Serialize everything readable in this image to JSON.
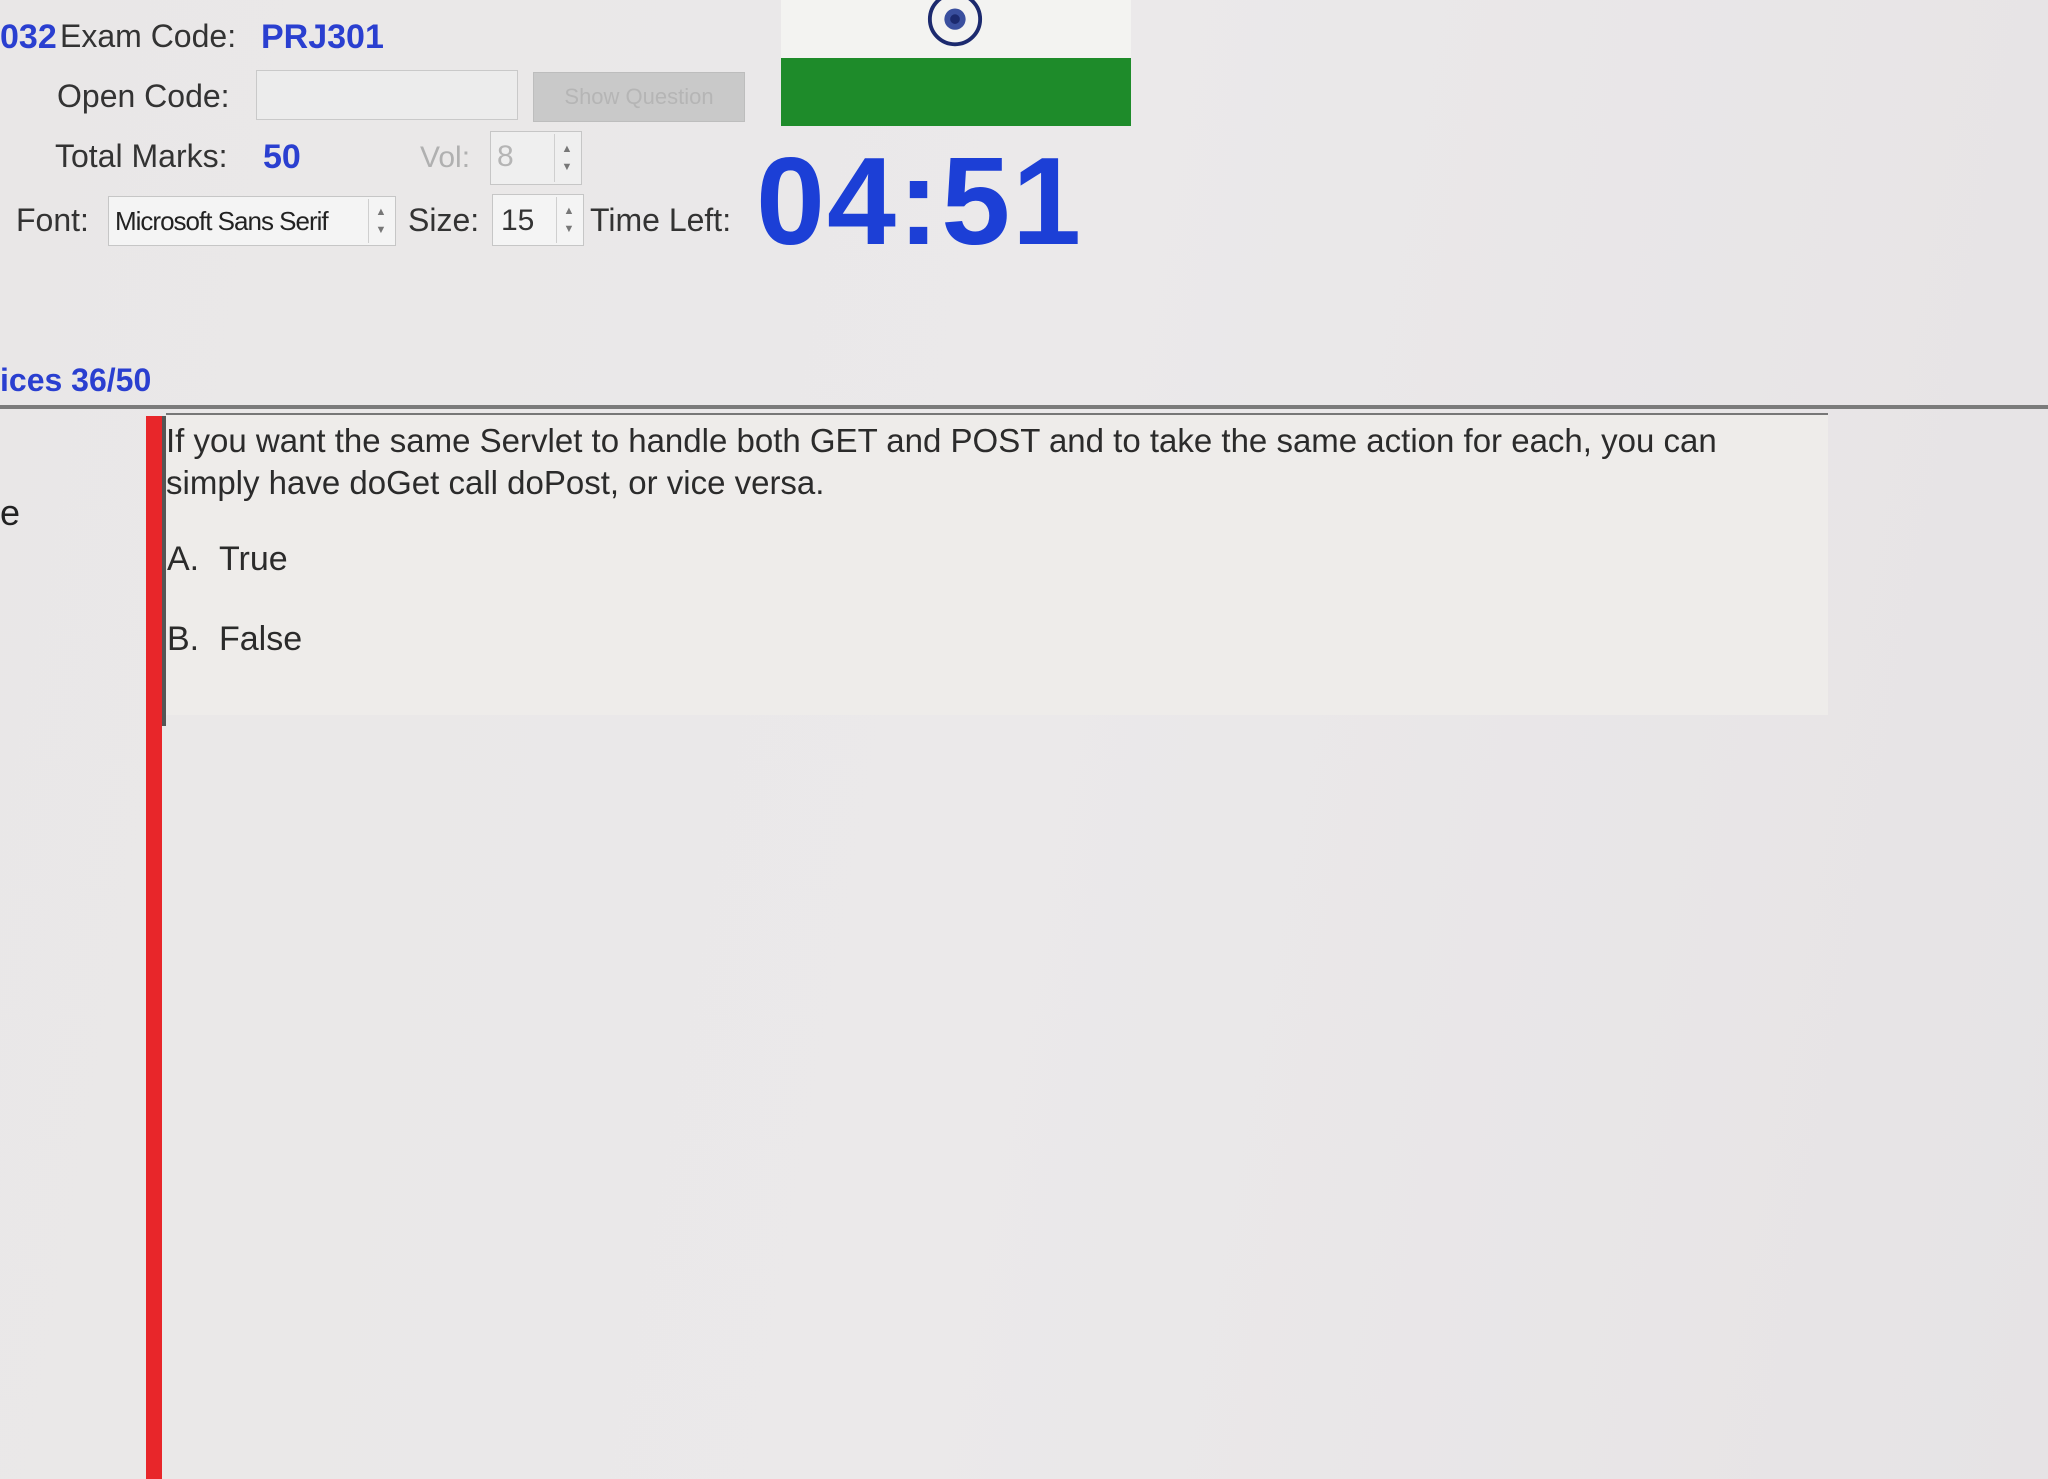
{
  "header": {
    "exam_prefix": "032",
    "exam_code_label": "Exam Code:",
    "exam_code": "PRJ301",
    "open_code_label": "Open Code:",
    "open_code_value": "",
    "show_question_label": "Show Question",
    "total_marks_label": "Total Marks:",
    "total_marks": "50",
    "vol_label": "Vol:",
    "vol_value": "8",
    "font_label": "Font:",
    "font_value": "Microsoft Sans Serif",
    "size_label": "Size:",
    "size_value": "15",
    "time_left_label": "Time Left:",
    "time_left": "04:51"
  },
  "flag": {
    "top_color": "#f3f3f1",
    "bottom_color": "#1e8b2a",
    "emblem": "ashoka-chakra-icon"
  },
  "progress": {
    "label": "ices 36/50"
  },
  "left_panel": {
    "glyph": "e"
  },
  "question": {
    "text": "If you want the same Servlet to handle both GET and POST and to take the same action for each, you can simply have doGet call doPost, or vice versa.",
    "options": [
      {
        "letter": "A.",
        "text": "True"
      },
      {
        "letter": "B.",
        "text": "False"
      }
    ]
  },
  "colors": {
    "accent_blue": "#1c3fd6",
    "red_bar": "#e8262a"
  }
}
